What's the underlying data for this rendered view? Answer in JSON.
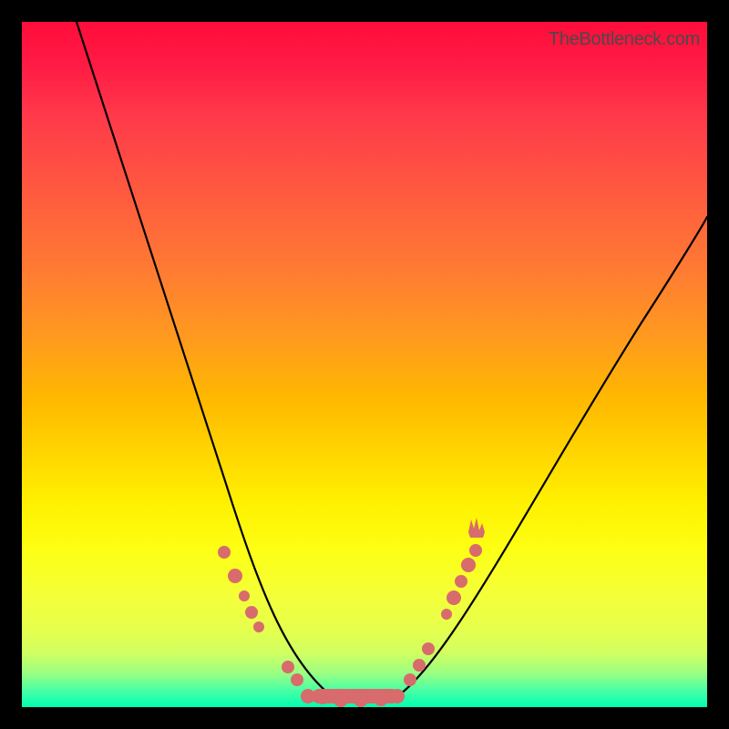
{
  "watermark": {
    "text": "TheBottleneck.com"
  },
  "chart_data": {
    "type": "line",
    "title": "",
    "xlabel": "",
    "ylabel": "",
    "xlim": [
      0,
      100
    ],
    "ylim": [
      0,
      100
    ],
    "grid": false,
    "legend": false,
    "series": [
      {
        "name": "bottleneck-curve",
        "x": [
          8,
          12,
          16,
          20,
          24,
          28,
          30,
          32,
          34,
          36,
          38,
          40,
          42,
          44,
          46,
          48,
          50,
          52,
          54,
          56,
          60,
          66,
          74,
          84,
          94,
          100
        ],
        "values": [
          100,
          88,
          77,
          66,
          55,
          44,
          38,
          33,
          28,
          23,
          18,
          13,
          8,
          4,
          2,
          1,
          1,
          2,
          4,
          8,
          15,
          24,
          36,
          48,
          58,
          63
        ]
      }
    ],
    "markers": [
      {
        "x": 29,
        "y": 21,
        "r": 6
      },
      {
        "x": 31,
        "y": 25,
        "r": 7
      },
      {
        "x": 33,
        "y": 28,
        "r": 5
      },
      {
        "x": 34.5,
        "y": 30,
        "r": 6
      },
      {
        "x": 36,
        "y": 31.5,
        "r": 5
      },
      {
        "x": 39.5,
        "y": 8,
        "r": 6
      },
      {
        "x": 41,
        "y": 5,
        "r": 6
      },
      {
        "x": 43,
        "y": 2.5,
        "r": 7
      },
      {
        "x": 56,
        "y": 6,
        "r": 6
      },
      {
        "x": 57.5,
        "y": 9,
        "r": 6
      },
      {
        "x": 59,
        "y": 12,
        "r": 6
      },
      {
        "x": 62,
        "y": 21,
        "r": 7
      },
      {
        "x": 63.5,
        "y": 24,
        "r": 6
      },
      {
        "x": 64.5,
        "y": 26,
        "r": 7
      },
      {
        "x": 65.5,
        "y": 28,
        "r": 6
      }
    ],
    "trough_band": {
      "x_start": 43,
      "x_end": 55,
      "y": 1,
      "height": 2.5
    },
    "flame_marker": {
      "x": 64,
      "y": 30
    }
  },
  "colors": {
    "curve_stroke": "#000000",
    "marker_fill": "#d86b6b"
  }
}
